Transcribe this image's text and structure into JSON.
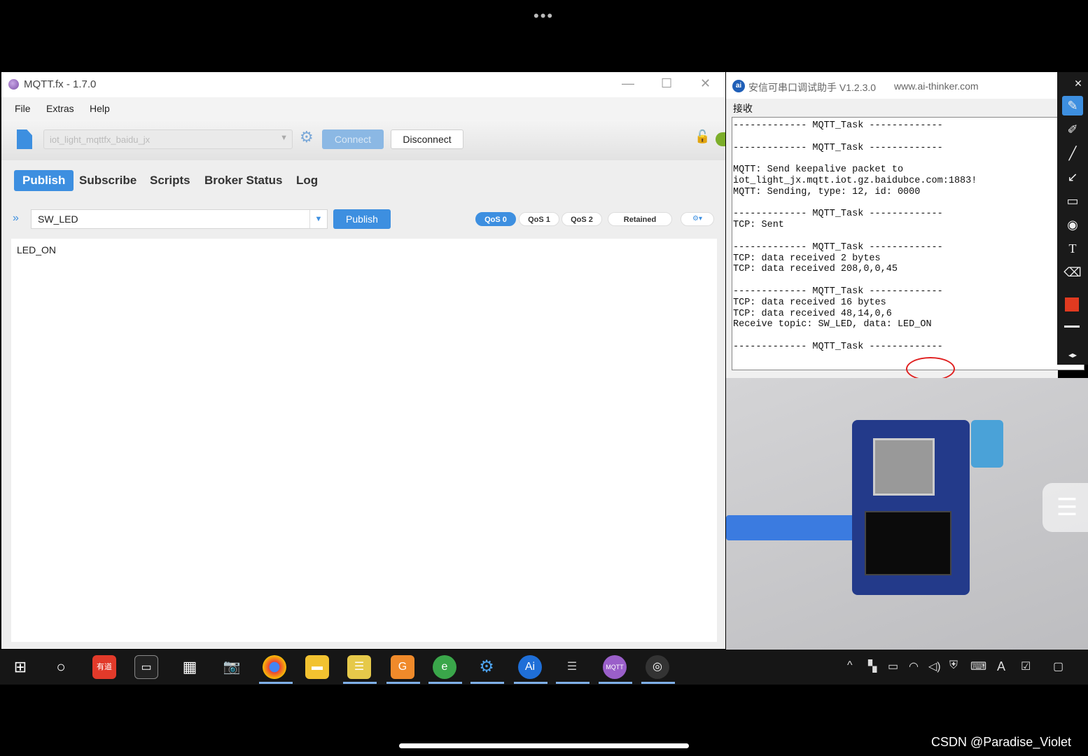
{
  "mqtt": {
    "title": "MQTT.fx - 1.7.0",
    "menu": [
      "File",
      "Extras",
      "Help"
    ],
    "profile": "iot_light_mqttfx_baidu_jx",
    "connect_label": "Connect",
    "disconnect_label": "Disconnect",
    "tabs": [
      "Publish",
      "Subscribe",
      "Scripts",
      "Broker Status",
      "Log"
    ],
    "topic": "SW_LED",
    "publish_label": "Publish",
    "qos": [
      "QoS 0",
      "QoS 1",
      "QoS 2"
    ],
    "retained": "Retained",
    "payload": "LED_ON",
    "colors": {
      "accent": "#3d8fe0",
      "status": "#7cae2a"
    }
  },
  "serial": {
    "title": "安信可串口调试助手 V1.2.3.0",
    "url": "www.ai-thinker.com",
    "recv_label": "接收",
    "log": [
      "------------- MQTT_Task -------------",
      "",
      "------------- MQTT_Task -------------",
      "",
      "MQTT: Send keepalive packet to",
      "iot_light_jx.mqtt.iot.gz.baidubce.com:1883!",
      "MQTT: Sending, type: 12, id: 0000",
      "",
      "------------- MQTT_Task -------------",
      "TCP: Sent",
      "",
      "------------- MQTT_Task -------------",
      "TCP: data received 2 bytes",
      "TCP: data received 208,0,0,45",
      "",
      "------------- MQTT_Task -------------",
      "TCP: data received 16 bytes",
      "TCP: data received 48,14,0,6",
      "Receive topic: SW_LED, data: LED_ON",
      "",
      "------------- MQTT_Task -------------"
    ]
  },
  "watermark": "CSDN @Paradise_Violet"
}
